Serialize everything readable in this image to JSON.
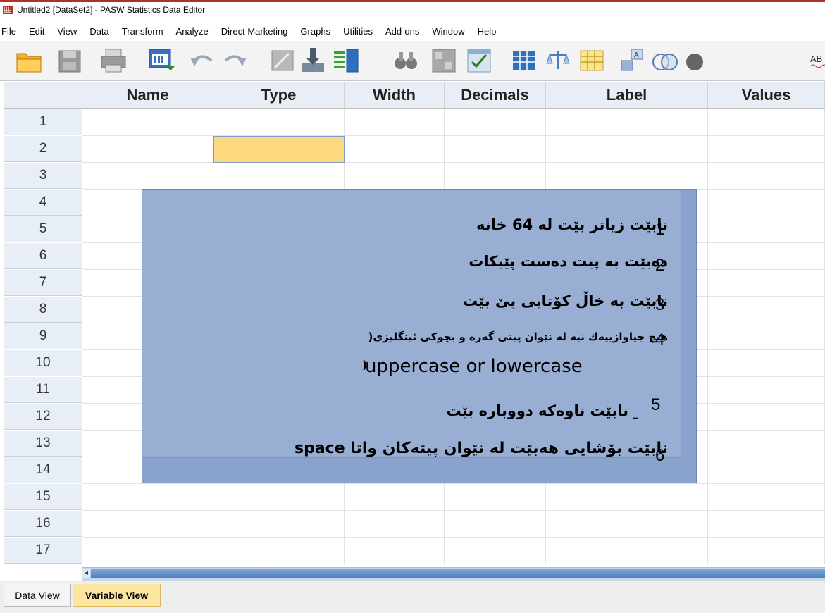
{
  "window": {
    "title": "Untitled2 [DataSet2] - PASW Statistics Data Editor"
  },
  "menu": [
    "File",
    "Edit",
    "View",
    "Data",
    "Transform",
    "Analyze",
    "Direct Marketing",
    "Graphs",
    "Utilities",
    "Add-ons",
    "Window",
    "Help"
  ],
  "toolbar": {
    "icons": [
      "open-folder-icon",
      "save-icon",
      "print-icon",
      "dialog-recall-icon",
      "undo-icon",
      "redo-icon",
      "goto-case-icon",
      "goto-variable-icon",
      "variables-icon",
      "find-icon",
      "split-file-icon",
      "select-cases-icon",
      "insert-cases-icon",
      "weight-cases-icon",
      "value-labels-icon",
      "use-sets-icon",
      "show-sets-icon",
      "spell-check-icon"
    ],
    "spell_label": "AB"
  },
  "grid": {
    "columns": [
      "",
      "Name",
      "Type",
      "Width",
      "Decimals",
      "Label",
      "Values"
    ],
    "rows": [
      "1",
      "2",
      "3",
      "4",
      "5",
      "6",
      "7",
      "8",
      "9",
      "10",
      "11",
      "12",
      "13",
      "14",
      "15",
      "16",
      "17"
    ]
  },
  "note": {
    "lines": [
      {
        "num": "1",
        "text": "نابێت زیاتر بێت له 64 خانه"
      },
      {
        "num": "2",
        "text": "دەبێت بە پیت دەست پێبکات"
      },
      {
        "num": "3",
        "text": "نابێت بە خاڵ کۆتایی پێ بێت"
      },
      {
        "num": "4",
        "text": "هیچ جیاوازییەك نیە لە نێوان پیتی گەره و بچوکی ئینگلیزی("
      },
      {
        "num": "",
        "text": "uppercase or lowercase"
      },
      {
        "num": "5",
        "text": "نابێت ناوەکه دووباره بێت"
      },
      {
        "num": "6",
        "text": "نابێت بۆشایی هەبێت له نێوان پیتەکان واتا space"
      }
    ],
    "dash": "-",
    "paren": ")"
  },
  "tabs": {
    "data_view": "Data View",
    "variable_view": "Variable View"
  },
  "colors": {
    "selected_cell": "#fcd87e",
    "note_bg": "#8aa3cc",
    "active_tab": "#fde6a2"
  }
}
